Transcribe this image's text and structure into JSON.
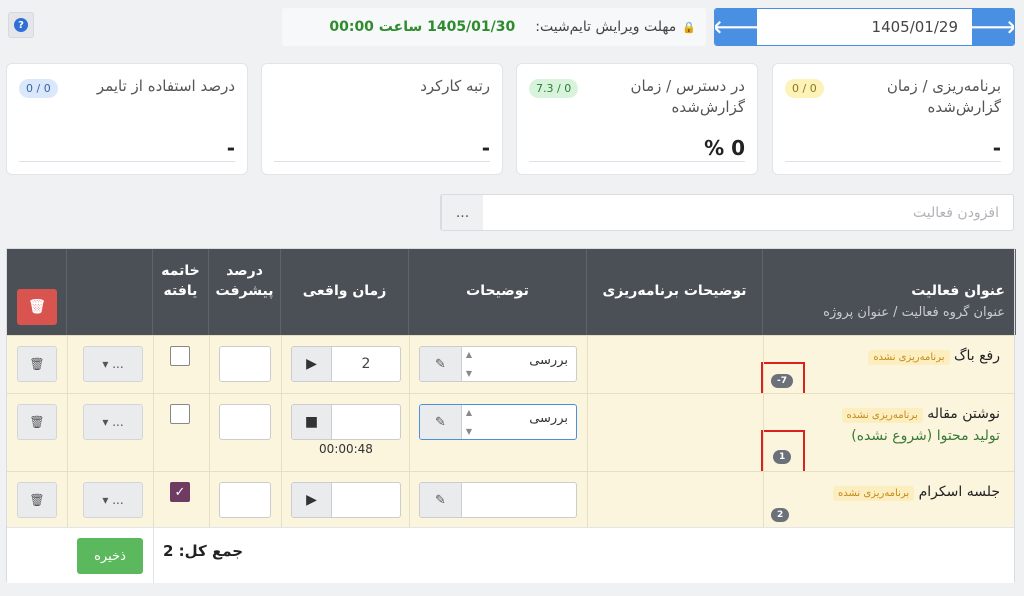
{
  "header": {
    "help_icon": "question-circle-icon",
    "deadline_label": "مهلت ویرایش تایم‌شیت:",
    "deadline_value": "1405/01/30 ساعت 00:00",
    "date_value": "1405/01/29",
    "prev_icon": "arrow-left-icon",
    "next_icon": "arrow-right-icon"
  },
  "cards": [
    {
      "title": "برنامه‌ریزی / زمان گزارش‌شده",
      "badge": "0 / 0",
      "badge_color": "#fdf3b8",
      "value": "-"
    },
    {
      "title": "در دسترس / زمان گزارش‌شده",
      "badge": "7.3 / 0",
      "badge_color": "#d7f3dc",
      "value": "% 0"
    },
    {
      "title": "رتبه کارکرد",
      "badge": "",
      "badge_color": "",
      "value": "-"
    },
    {
      "title": "درصد استفاده از تایمر",
      "badge": "0 / 0",
      "badge_color": "#dbe8fb",
      "value": "-"
    }
  ],
  "add_activity": {
    "placeholder": "افزودن فعالیت",
    "more": "..."
  },
  "table": {
    "headers": {
      "activity_title": "عنوان فعالیت",
      "activity_sub": "عنوان گروه فعالیت  / عنوان پروژه",
      "planning_desc": "توضیحات برنامه‌ریزی",
      "desc": "توضیحات",
      "actual_time": "زمان واقعی",
      "progress": "درصد پیشرفت",
      "done": "خاتمه یافته"
    },
    "rows": [
      {
        "title": "رفع باگ",
        "tag": "برنامه‌ریزی نشده",
        "sub": "",
        "pill": "-7",
        "desc": "بررسی",
        "time": "2",
        "timer": "",
        "timer_icon": "play-icon",
        "checked": false
      },
      {
        "title": "نوشتن مقاله",
        "tag": "برنامه‌ریزی نشده",
        "sub": "تولید محتوا (شروع نشده)",
        "pill": "1",
        "desc": "بررسی",
        "time": "",
        "timer": "00:00:48",
        "timer_icon": "stop-icon",
        "checked": false
      },
      {
        "title": "جلسه اسکرام",
        "tag": "برنامه‌ریزی نشده",
        "sub": "",
        "pill": "2",
        "desc": "",
        "time": "",
        "timer": "",
        "timer_icon": "play-icon",
        "checked": true
      }
    ],
    "more_label": "...",
    "total": "جمع کل: 2",
    "save_label": "ذخیره"
  }
}
